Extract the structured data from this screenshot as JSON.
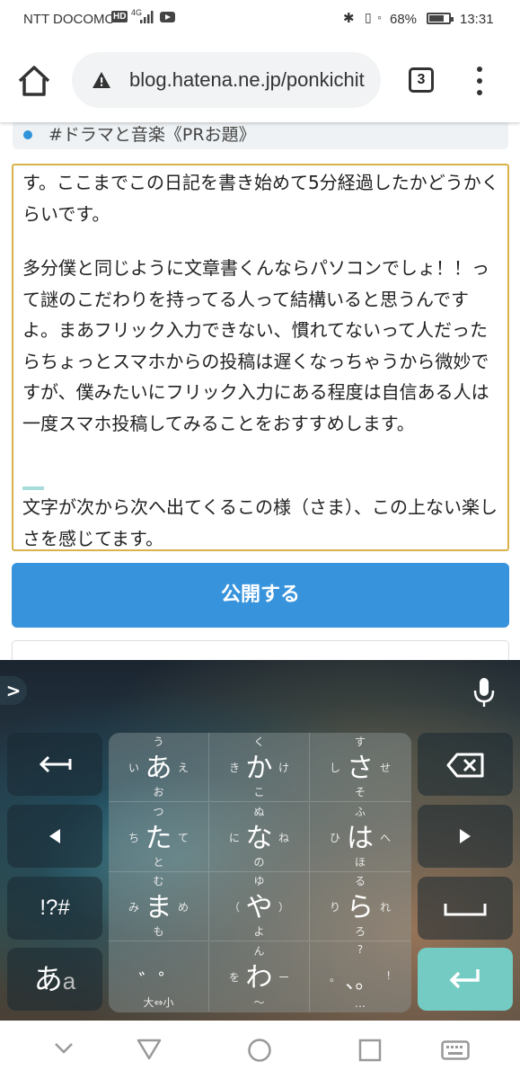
{
  "status_bar": {
    "carrier": "NTT DOCOMO",
    "hd_badge": "HD",
    "network": "4G",
    "battery_percent": "68%",
    "battery_level": 0.68,
    "time": "13:31"
  },
  "browser": {
    "url": "blog.hatena.ne.jp/ponkichit",
    "tab_count": "3"
  },
  "page": {
    "tag_text": "#ドラマと音楽《PRお題》",
    "editor_paragraphs": [
      "す。ここまでこの日記を書き始めて5分経過したかどうかくらいです。",
      "多分僕と同じように文章書くんならパソコンでしょ！！って謎のこだわりを持ってる人って結構いると思うんですよ。まあフリック入力できない、慣れてないって人だったらちょっとスマホからの投稿は遅くなっちゃうから微妙ですが、僕みたいにフリック入力にある程度は自信ある人は一度スマホ投稿してみることをおすすめします。",
      "文字が次から次へ出てくるこの様（さま）、この上ない楽しさを感じてます。"
    ],
    "publish_label": "公開する"
  },
  "keyboard": {
    "expand_label": ">",
    "side_left": {
      "symbols_label": "!?#",
      "kana_toggle_main": "あ",
      "kana_toggle_sub": "a"
    },
    "keys": [
      {
        "main": "あ",
        "up": "う",
        "left": "い",
        "right": "え",
        "down": "お"
      },
      {
        "main": "か",
        "up": "く",
        "left": "き",
        "right": "け",
        "down": "こ"
      },
      {
        "main": "さ",
        "up": "す",
        "left": "し",
        "right": "せ",
        "down": "そ"
      },
      {
        "main": "た",
        "up": "つ",
        "left": "ち",
        "right": "て",
        "down": "と"
      },
      {
        "main": "な",
        "up": "ぬ",
        "left": "に",
        "right": "ね",
        "down": "の"
      },
      {
        "main": "は",
        "up": "ふ",
        "left": "ひ",
        "right": "へ",
        "down": "ほ"
      },
      {
        "main": "ま",
        "up": "む",
        "left": "み",
        "right": "め",
        "down": "も"
      },
      {
        "main": "や",
        "up": "ゆ",
        "left": "（",
        "right": "）",
        "down": "よ"
      },
      {
        "main": "ら",
        "up": "る",
        "left": "り",
        "right": "れ",
        "down": "ろ"
      },
      {
        "main": "゛゜",
        "up": "",
        "left": "",
        "right": "",
        "down": "大⇔小"
      },
      {
        "main": "わ",
        "up": "ん",
        "left": "を",
        "right": "ー",
        "down": "〜"
      },
      {
        "main": "、。",
        "up": "?",
        "left": "。",
        "right": "!",
        "down": "…"
      }
    ]
  }
}
